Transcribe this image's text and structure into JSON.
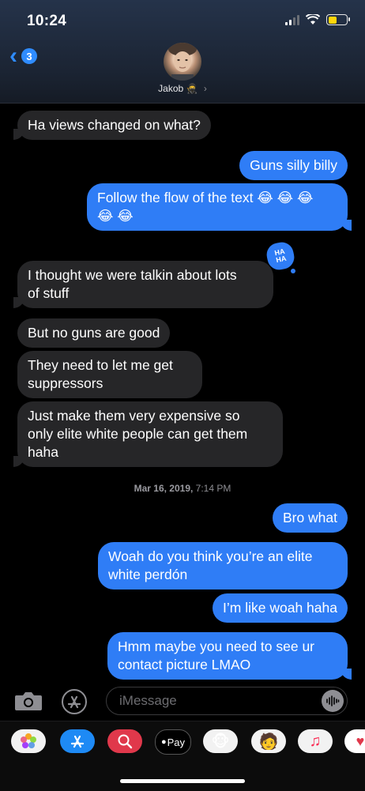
{
  "status": {
    "time": "10:24"
  },
  "nav": {
    "back_count": "3",
    "contact_name": "Jakob"
  },
  "messages": {
    "m1": "Ha views changed on what?",
    "m2": "Guns silly billy",
    "m3": "Follow the flow of the text 😂 😂 😂\n😂 😂",
    "m4": "I thought we were talkin about lots\nof stuff",
    "m5": "But no guns are good",
    "m6": "They need to let me get\nsuppressors",
    "m7": "Just make them very expensive so\nonly elite white people can get them\nhaha",
    "m8": "Bro what",
    "m9": "Woah do you think you’re an elite\nwhite perdón",
    "m10": "I’m like woah haha",
    "m11": "Hmm maybe you need to see ur\ncontact picture LMAO"
  },
  "tapback": {
    "label": "HA\nHA"
  },
  "timestamp": {
    "date": "Mar 16, 2019,",
    "time": "7:14 PM"
  },
  "input": {
    "placeholder": "iMessage"
  },
  "tray": {
    "apple_pay_label": "Pay"
  }
}
